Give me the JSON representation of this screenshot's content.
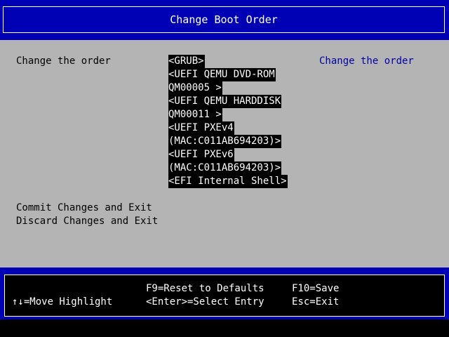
{
  "title": "Change Boot Order",
  "order_label": "Change the order",
  "help_text": "Change the order",
  "boot_list_lines": [
    "<GRUB>",
    "<UEFI QEMU DVD-ROM",
    "QM00005 >",
    "<UEFI QEMU HARDDISK",
    "QM00011 >",
    "<UEFI PXEv4",
    "(MAC:C011AB694203)>",
    "<UEFI PXEv6",
    "(MAC:C011AB694203)>",
    "<EFI Internal Shell>"
  ],
  "actions": {
    "commit": "Commit Changes and Exit",
    "discard": "Discard Changes and Exit"
  },
  "footer": {
    "move_highlight": "↑↓=Move Highlight",
    "reset_defaults": "F9=Reset to Defaults",
    "select_entry": "<Enter>=Select Entry",
    "save": "F10=Save",
    "exit": "Esc=Exit"
  },
  "colors": {
    "background": "#b4b4b4",
    "title_bar": "#0000b4",
    "highlight_bg": "#000000",
    "help_text": "#0000a8"
  }
}
